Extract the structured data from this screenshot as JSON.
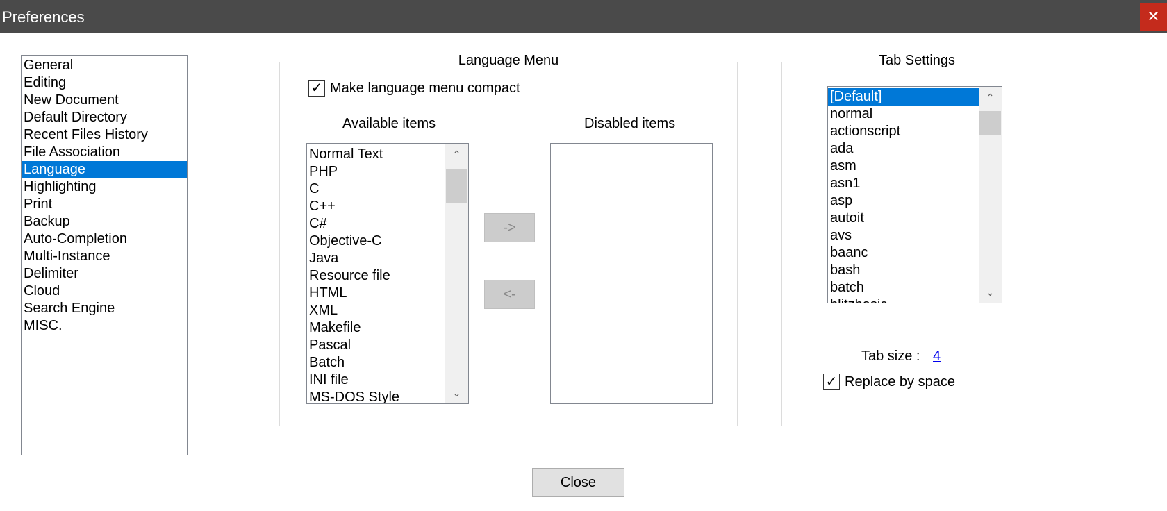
{
  "window": {
    "title": "Preferences",
    "close_glyph": "✕"
  },
  "categories": {
    "items": [
      "General",
      "Editing",
      "New Document",
      "Default Directory",
      "Recent Files History",
      "File Association",
      "Language",
      "Highlighting",
      "Print",
      "Backup",
      "Auto-Completion",
      "Multi-Instance",
      "Delimiter",
      "Cloud",
      "Search Engine",
      "MISC."
    ],
    "selected": "Language"
  },
  "language_menu": {
    "title": "Language Menu",
    "compact_label": "Make language menu compact",
    "compact_checked": true,
    "available_title": "Available items",
    "disabled_title": "Disabled items",
    "available_items": [
      "Normal Text",
      "PHP",
      "C",
      "C++",
      "C#",
      "Objective-C",
      "Java",
      "Resource file",
      "HTML",
      "XML",
      "Makefile",
      "Pascal",
      "Batch",
      "INI file",
      "MS-DOS Style"
    ],
    "disabled_items": [],
    "move_right_label": "->",
    "move_left_label": "<-"
  },
  "tab_settings": {
    "title": "Tab Settings",
    "languages": [
      "[Default]",
      "normal",
      "actionscript",
      "ada",
      "asm",
      "asn1",
      "asp",
      "autoit",
      "avs",
      "baanc",
      "bash",
      "batch",
      "blitzbasic"
    ],
    "selected": "[Default]",
    "tab_size_label": "Tab size :",
    "tab_size_value": "4",
    "replace_label": "Replace by space",
    "replace_checked": true
  },
  "footer": {
    "close_label": "Close"
  },
  "icons": {
    "check": "✓",
    "scroll_up": "⌃",
    "scroll_down": "⌄"
  },
  "colors": {
    "selection": "#0078d7",
    "titlebar": "#4a4a4a",
    "close_button": "#c42b1c"
  }
}
